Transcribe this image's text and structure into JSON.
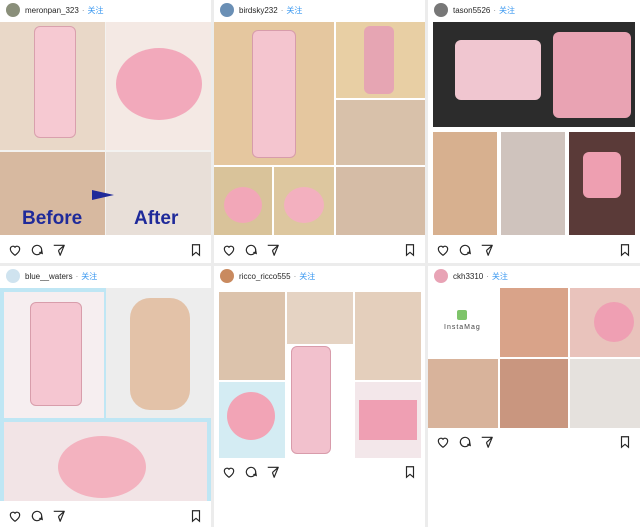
{
  "follow_label": "关注",
  "dot": "·",
  "posts": [
    {
      "username": "meronpan_323",
      "before_label": "Before",
      "after_label": "After"
    },
    {
      "username": "birdsky232"
    },
    {
      "username": "tason5526"
    },
    {
      "username": "blue__waters"
    },
    {
      "username": "ricco_ricco555"
    },
    {
      "username": "ckh3310",
      "watermark": "InstaMag"
    }
  ],
  "icons": [
    "heart-icon",
    "comment-icon",
    "share-icon",
    "bookmark-icon"
  ],
  "colors": {
    "follow": "#3897f0",
    "pink": "#f1a6b6",
    "label": "#1f2a9a"
  }
}
